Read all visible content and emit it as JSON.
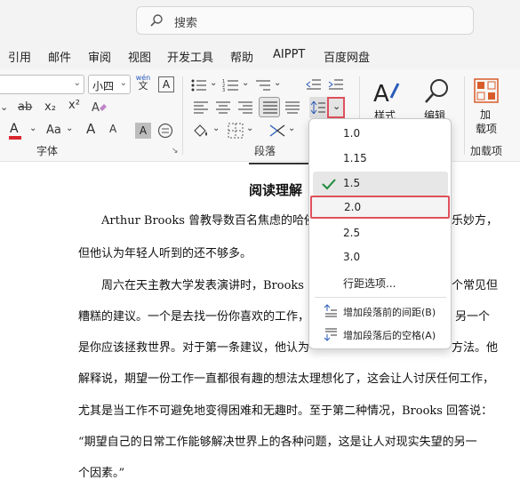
{
  "search": {
    "placeholder": "搜索"
  },
  "menu": [
    "引用",
    "邮件",
    "审阅",
    "视图",
    "开发工具",
    "帮助",
    "AIPPT",
    "百度网盘"
  ],
  "ribbon": {
    "font_size": "小四",
    "wen_top": "wén",
    "wen_bottom": "文",
    "font_group_label": "字体",
    "paragraph_group_label": "段落",
    "addins_group_label": "加载项",
    "style_label": "样式",
    "edit_label": "编辑",
    "addin_label_line1": "加",
    "addin_label_line2": "载项",
    "font_btn_aa": "Aa",
    "font_grow": "A",
    "font_shrink": "A",
    "highlight_a": "A",
    "sub_label": "x₂",
    "sup_label": "x²",
    "strike_label": "ab"
  },
  "line_spacing_menu": {
    "options": [
      "1.0",
      "1.15",
      "1.5",
      "2.0",
      "2.5",
      "3.0"
    ],
    "checked": "1.5",
    "selected": "2.0",
    "more": "行距选项...",
    "add_before": "增加段落前的间距(B)",
    "add_after": "增加段落后的空格(A)"
  },
  "document": {
    "title": "阅读理解",
    "lines": [
      "Arthur Brooks 曾教导数百名焦虑的哈佛",
      "乐妙方，",
      "但他认为年轻人听到的还不够多。",
      "周六在天主教大学发表演讲时，Brooks",
      "个常见但",
      "糟糕的建议。一个是去找一份你喜欢的工作，",
      "另一个",
      "是你应该拯救世界。对于第一条建议，他认为",
      "方法。他",
      "解释说，期望一份工作一直都很有趣的想法太理想化了，这会让人讨厌任何工作，",
      "尤其是当工作不可避免地变得困难和无趣时。至于第二种情况，Brooks 回答说：",
      "“期望自己的日常工作能够解决世界上的各种问题，这是让人对现实失望的另一",
      "个因素。”"
    ]
  },
  "colors": {
    "accent_red": "#e0505c",
    "font_color_red": "#d9262c",
    "check_green": "#1f8a3c"
  }
}
